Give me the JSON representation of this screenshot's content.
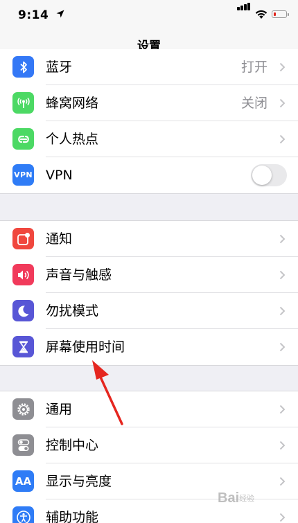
{
  "status_bar": {
    "time": "9:14"
  },
  "nav": {
    "title": "设置"
  },
  "group1": [
    {
      "label": "蓝牙",
      "value": "打开",
      "icon": "bluetooth-icon",
      "color": "#3478f6"
    },
    {
      "label": "蜂窝网络",
      "value": "关闭",
      "icon": "antenna-icon",
      "color": "#4cd964"
    },
    {
      "label": "个人热点",
      "value": "",
      "icon": "hotspot-link-icon",
      "color": "#4cd964"
    },
    {
      "label": "VPN",
      "value": "",
      "icon": "vpn-icon",
      "color": "#2f7cf6",
      "icon_text": "VPN",
      "toggle_on": false
    }
  ],
  "group2": [
    {
      "label": "通知",
      "icon": "notification-icon",
      "color": "#f0473e"
    },
    {
      "label": "声音与触感",
      "icon": "speaker-icon",
      "color": "#f13a5b"
    },
    {
      "label": "勿扰模式",
      "icon": "moon-icon",
      "color": "#5856d6"
    },
    {
      "label": "屏幕使用时间",
      "icon": "hourglass-icon",
      "color": "#5856d6"
    }
  ],
  "group3": [
    {
      "label": "通用",
      "icon": "gear-icon",
      "color": "#8e8e93"
    },
    {
      "label": "控制中心",
      "icon": "switches-icon",
      "color": "#8e8e93"
    },
    {
      "label": "显示与亮度",
      "icon": "display-icon",
      "color": "#2f7cf6",
      "icon_text": "AA"
    },
    {
      "label": "辅助功能",
      "icon": "accessibility-icon",
      "color": "#2f7cf6"
    }
  ],
  "watermark": {
    "brand": "Bai",
    "suffix": "经验"
  }
}
